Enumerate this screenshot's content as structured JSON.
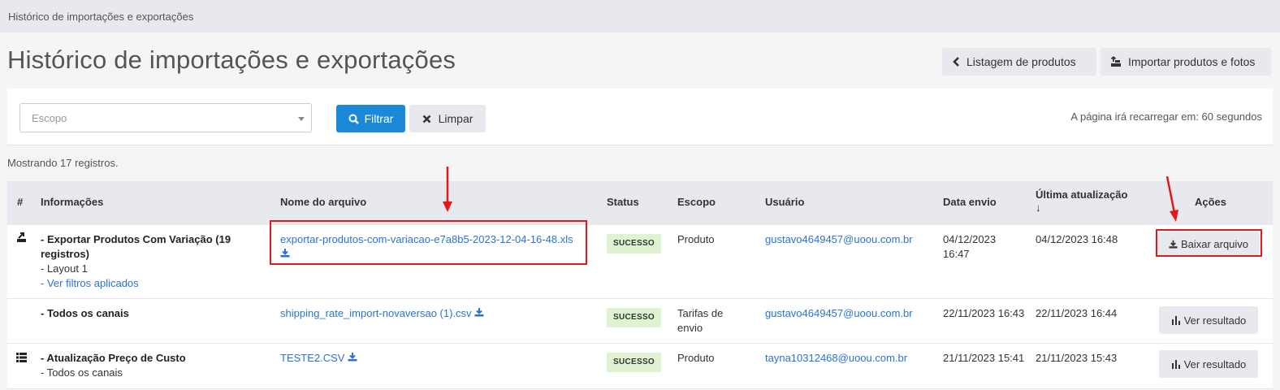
{
  "breadcrumb": "Histórico de importações e exportações",
  "page_title": "Histórico de importações e exportações",
  "top_buttons": {
    "listagem": "Listagem de produtos",
    "importar": "Importar produtos e fotos"
  },
  "filter": {
    "scope_placeholder": "Escopo",
    "filter_label": "Filtrar",
    "clear_label": "Limpar",
    "reload_text": "A página irá recarregar em: 60 segundos"
  },
  "records_count": "Mostrando 17 registros.",
  "table": {
    "headers": {
      "num": "#",
      "info": "Informações",
      "file": "Nome do arquivo",
      "status": "Status",
      "scope": "Escopo",
      "user": "Usuário",
      "sent": "Data envio",
      "updated": "Última atualização",
      "updated_sort": "↓",
      "actions": "Ações"
    },
    "rows": [
      {
        "title": "- Exportar Produtos Com Variação (19 registros)",
        "sub1": "- Layout 1",
        "sub2": "- Ver filtros aplicados",
        "file": "exportar-produtos-com-variacao-e7a8b5-2023-12-04-16-48.xls",
        "status": "SUCESSO",
        "scope": "Produto",
        "user": "gustavo4649457@uoou.com.br",
        "sent": "04/12/2023 16:47",
        "updated": "04/12/2023 16:48",
        "action": "Baixar arquivo"
      },
      {
        "title": "- Todos os canais",
        "file": "shipping_rate_import-novaversao (1).csv",
        "status": "SUCESSO",
        "scope": "Tarifas de envio",
        "user": "gustavo4649457@uoou.com.br",
        "sent": "22/11/2023 16:43",
        "updated": "22/11/2023 16:44",
        "action": "Ver resultado"
      },
      {
        "title": "- Atualização Preço de Custo",
        "sub1": "- Todos os canais",
        "file": "TESTE2.CSV",
        "status": "SUCESSO",
        "scope": "Produto",
        "user": "tayna10312468@uoou.com.br",
        "sent": "21/11/2023 15:41",
        "updated": "21/11/2023 15:43",
        "action": "Ver resultado"
      }
    ]
  },
  "colors": {
    "primary": "#1a8ad8",
    "link": "#2a72d4",
    "success_badge": "#dff3d0",
    "annotation": "#e4171b"
  }
}
